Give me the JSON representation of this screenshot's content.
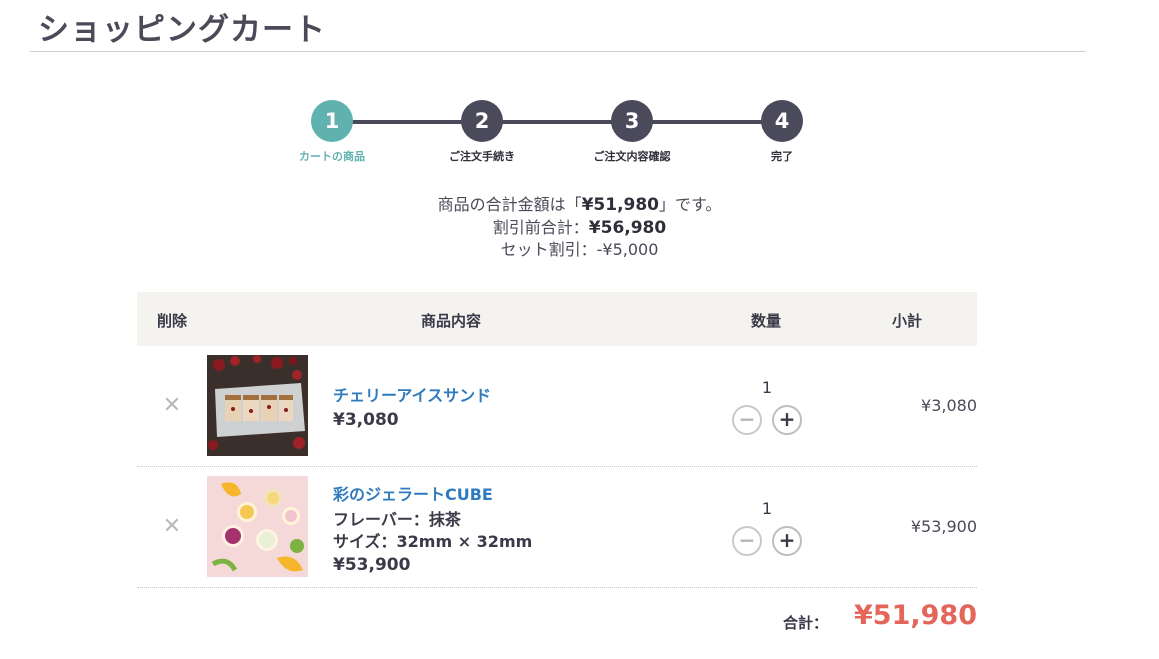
{
  "page": {
    "title": "ショッピングカート"
  },
  "steps": [
    {
      "num": "1",
      "label": "カートの商品",
      "active": true
    },
    {
      "num": "2",
      "label": "ご注文手続き",
      "active": false
    },
    {
      "num": "3",
      "label": "ご注文内容確認",
      "active": false
    },
    {
      "num": "4",
      "label": "完了",
      "active": false
    }
  ],
  "summary": {
    "line1_prefix": "商品の合計金額は「",
    "line1_amount": "¥51,980",
    "line1_suffix": "」です。",
    "line2_prefix": "割引前合計：",
    "line2_amount": "¥56,980",
    "line3": "セット割引：-¥5,000"
  },
  "table": {
    "headers": {
      "remove": "削除",
      "content": "商品内容",
      "qty": "数量",
      "subtotal": "小計"
    },
    "items": [
      {
        "name": "チェリーアイスサンド",
        "attrs": [],
        "price": "¥3,080",
        "qty": "1",
        "subtotal": "¥3,080",
        "image": "cherry-ice-sandwich-photo"
      },
      {
        "name": "彩のジェラートCUBE",
        "attrs": [
          "フレーバー：抹茶",
          "サイズ：32mm × 32mm"
        ],
        "price": "¥53,900",
        "qty": "1",
        "subtotal": "¥53,900",
        "image": "gelato-cube-photo"
      }
    ],
    "remove_icon": "close-icon",
    "minus_icon": "minus-icon",
    "plus_icon": "plus-icon"
  },
  "total": {
    "label": "合計：",
    "value": "¥51,980"
  },
  "colors": {
    "accent": "#5fb2ae",
    "step_inactive": "#4a4a5a",
    "link": "#2f7bbd",
    "total": "#e4665a",
    "header_bg": "#f4f3f0"
  }
}
